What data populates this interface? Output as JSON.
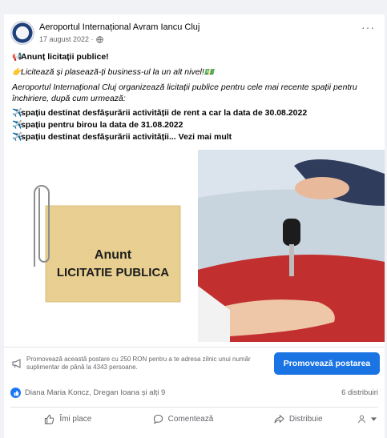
{
  "post": {
    "page_name": "Aeroportul Internațional Avram Iancu Cluj",
    "date": "17 august 2022 ·",
    "more": "···"
  },
  "body": {
    "line1_emoji": "📢",
    "line1": "Anunț licitații publice!",
    "line2_emoji": "👉",
    "line2": "Licitează și plasează-ți business-ul la un alt nivel!",
    "line2_end_emoji": "💵",
    "para": "Aeroportul Internațional Cluj organizează licitații publice pentru cele mai recente spații pentru închiriere, după cum urmează:",
    "bullet_emoji": "✈️",
    "items": [
      "spațiu destinat desfășurării activității de rent a car la data de 30.08.2022",
      "spațiu pentru birou la data de 31.08.2022",
      "spațiu destinat desfășurării activității..."
    ],
    "see_more": "Vezi mai mult"
  },
  "image": {
    "note_line1": "Anunt",
    "note_line2": "LICITATIE PUBLICA"
  },
  "promo": {
    "text": "Promovează această postare cu 250 RON pentru a te adresa zilnic unui număr suplimentar de până la 4343 persoane.",
    "button": "Promovează postarea"
  },
  "reactions": {
    "names": "Diana Maria Koncz, Dregan Ioana și alți 9",
    "shares": "6 distribuiri"
  },
  "actions": {
    "like": "Îmi place",
    "comment": "Comentează",
    "share": "Distribuie"
  },
  "colors": {
    "primary": "#1b74e4",
    "secondary_text": "#65676b",
    "note": "#e9d193"
  }
}
